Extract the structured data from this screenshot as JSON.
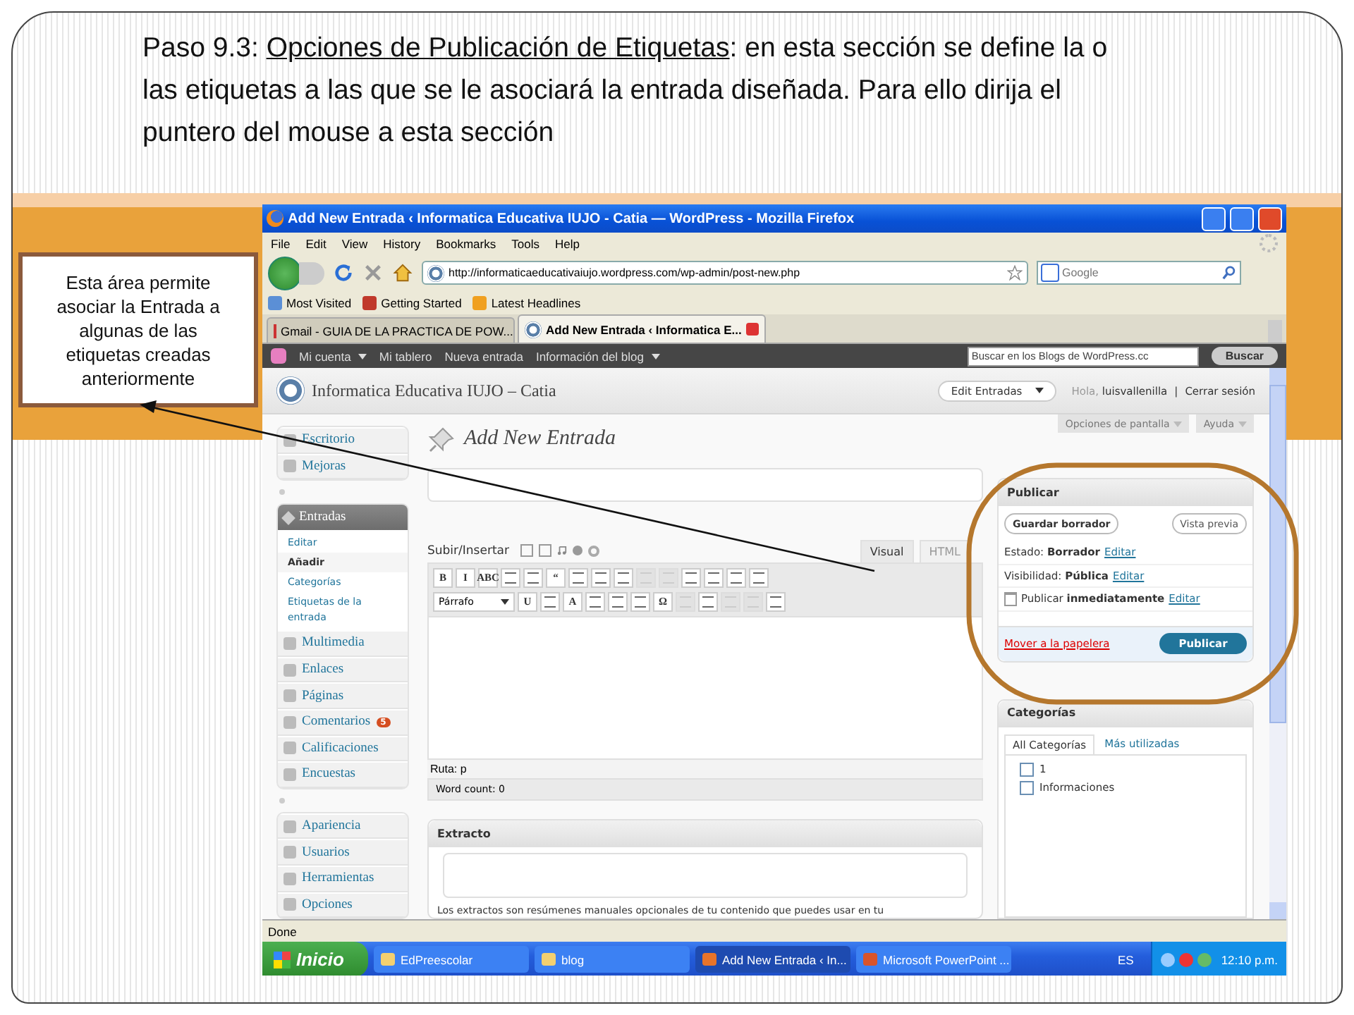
{
  "slide": {
    "heading": [
      {
        "text": "Paso 9.3: ",
        "underlined": false
      },
      {
        "text": "Opciones de Publicación de Etiquetas",
        "underlined": true
      },
      {
        "text": ": en esta sección se  define la o las etiquetas a las que se le asociará la entrada diseñada. Para ello dirija el puntero del mouse a esta sección",
        "underlined": false
      }
    ],
    "callout": "Esta área permite asociar la Entrada a algunas de las etiquetas creadas anteriormente"
  },
  "browser": {
    "title": "Add New Entrada ‹ Informatica Educativa IUJO - Catia — WordPress - Mozilla Firefox",
    "menu": [
      "File",
      "Edit",
      "View",
      "History",
      "Bookmarks",
      "Tools",
      "Help"
    ],
    "url": "http://informaticaeducativaiujo.wordpress.com/wp-admin/post-new.php",
    "search_placeholder": "Google",
    "bookmarks": [
      {
        "label": "Most Visited",
        "kind": "smart"
      },
      {
        "label": "Getting Started",
        "kind": "page"
      },
      {
        "label": "Latest Headlines",
        "kind": "feed"
      }
    ],
    "tabs": [
      {
        "label": "Gmail - GUIA DE LA PRACTICA DE POW...",
        "kind": "mail",
        "selected": false
      },
      {
        "label": "Add New Entrada ‹ Informatica E...",
        "kind": "site",
        "selected": true
      }
    ],
    "status": "Done"
  },
  "admin_bar": {
    "items": [
      {
        "label": "Mi cuenta",
        "dropdown": true
      },
      {
        "label": "Mi tablero",
        "dropdown": false
      },
      {
        "label": "Nueva entrada",
        "dropdown": false
      },
      {
        "label": "Información del blog",
        "dropdown": true
      }
    ],
    "search_placeholder": "Buscar en los Blogs de WordPress.cc",
    "button": "Buscar"
  },
  "wp": {
    "site_title": "Informatica Educativa IUJO – Catia",
    "edit_button": "Edit Entradas",
    "greeting": "Hola,",
    "user": "luisvallenilla",
    "separator": "|",
    "logout": "Cerrar sesión",
    "screen_options": "Opciones de pantalla",
    "help": "Ayuda",
    "menu_groups": [
      {
        "items": [
          {
            "label": "Escritorio"
          },
          {
            "label": "Mejoras"
          }
        ]
      },
      {
        "items": [
          {
            "label": "Entradas",
            "expanded": true,
            "children": [
              {
                "label": "Editar",
                "selected": false
              },
              {
                "label": "Añadir",
                "selected": true
              },
              {
                "label": "Categorías",
                "selected": false
              },
              {
                "label": "Etiquetas de la entrada",
                "selected": false
              }
            ]
          },
          {
            "label": "Multimedia"
          },
          {
            "label": "Enlaces"
          },
          {
            "label": "Páginas"
          },
          {
            "label": "Comentarios",
            "badge": "5"
          },
          {
            "label": "Calificaciones"
          },
          {
            "label": "Encuestas"
          }
        ]
      },
      {
        "items": [
          {
            "label": "Apariencia"
          },
          {
            "label": "Usuarios"
          },
          {
            "label": "Herramientas"
          },
          {
            "label": "Opciones"
          }
        ]
      }
    ],
    "page_title": "Add New Entrada",
    "upload_label": "Subir/Insertar",
    "editor_tabs": [
      {
        "label": "Visual",
        "selected": true
      },
      {
        "label": "HTML",
        "selected": false
      }
    ],
    "toolbar_rows": [
      [
        {
          "kind": "glyph",
          "text": "B",
          "disabled": false
        },
        {
          "kind": "glyph",
          "text": "I",
          "disabled": false
        },
        {
          "kind": "glyph",
          "text": "ABC",
          "disabled": false
        },
        {
          "kind": "icon",
          "disabled": false
        },
        {
          "kind": "icon",
          "disabled": false
        },
        {
          "kind": "glyph",
          "text": "“",
          "disabled": false
        },
        {
          "kind": "icon",
          "disabled": false
        },
        {
          "kind": "icon",
          "disabled": false
        },
        {
          "kind": "icon",
          "disabled": false
        },
        {
          "kind": "icon",
          "disabled": true
        },
        {
          "kind": "icon",
          "disabled": true
        },
        {
          "kind": "icon",
          "disabled": false
        },
        {
          "kind": "icon",
          "disabled": false
        },
        {
          "kind": "icon",
          "disabled": false
        },
        {
          "kind": "icon",
          "disabled": false
        }
      ],
      [
        {
          "kind": "select",
          "text": "Párrafo",
          "disabled": false
        },
        {
          "kind": "glyph",
          "text": "U",
          "disabled": false
        },
        {
          "kind": "icon",
          "disabled": false
        },
        {
          "kind": "glyph",
          "text": "A",
          "disabled": false
        },
        {
          "kind": "icon",
          "disabled": false
        },
        {
          "kind": "icon",
          "disabled": false
        },
        {
          "kind": "icon",
          "disabled": false
        },
        {
          "kind": "glyph",
          "text": "Ω",
          "disabled": false
        },
        {
          "kind": "icon",
          "disabled": true
        },
        {
          "kind": "icon",
          "disabled": false
        },
        {
          "kind": "icon",
          "disabled": true
        },
        {
          "kind": "icon",
          "disabled": true
        },
        {
          "kind": "icon",
          "disabled": false
        }
      ]
    ],
    "path": "Ruta: p",
    "word_count": "Word count: 0",
    "excerpt_title": "Extracto",
    "excerpt_text": "Los extractos son resúmenes manuales opcionales de tu contenido que puedes usar en tu",
    "publish": {
      "title": "Publicar",
      "save_draft": "Guardar borrador",
      "preview": "Vista previa",
      "rows": [
        {
          "kind": "status",
          "label": "Estado:",
          "value": "Borrador",
          "link": "Editar"
        },
        {
          "kind": "status",
          "label": "Visibilidad:",
          "value": "Pública",
          "link": "Editar"
        },
        {
          "kind": "schedule",
          "label": "Publicar",
          "value": "inmediatamente",
          "link": "Editar"
        }
      ],
      "trash": "Mover a la papelera",
      "button": "Publicar"
    },
    "categories": {
      "title": "Categorías",
      "tabs": [
        {
          "label": "All Categorías",
          "selected": true
        },
        {
          "label": "Más utilizadas",
          "selected": false
        }
      ],
      "items": [
        {
          "label": "1",
          "checked": false
        },
        {
          "label": "Informaciones",
          "checked": false
        }
      ]
    }
  },
  "taskbar": {
    "start": "Inicio",
    "tasks": [
      {
        "label": "EdPreescolar",
        "kind": "folder",
        "selected": false
      },
      {
        "label": "blog",
        "kind": "folder",
        "selected": false
      },
      {
        "label": "Add New Entrada ‹ In...",
        "kind": "browser",
        "selected": true
      },
      {
        "label": "Microsoft PowerPoint ...",
        "kind": "presentation",
        "selected": false
      }
    ],
    "language": "ES",
    "clock": "12:10 p.m."
  }
}
